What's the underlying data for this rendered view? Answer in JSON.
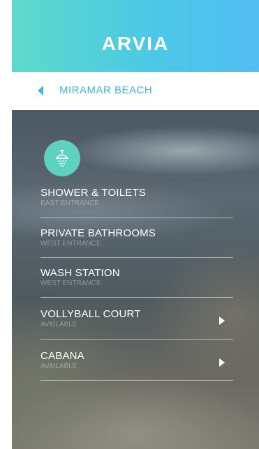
{
  "header": {
    "title": "ARVIA"
  },
  "nav": {
    "title": "MIRAMAR BEACH",
    "back_icon": "back-arrow-icon"
  },
  "category": {
    "icon": "shower-icon",
    "color": "#5ed1bf"
  },
  "facilities": [
    {
      "name": "SHOWER & TOILETS",
      "sub": "EAST ENTRANCE",
      "has_chevron": false
    },
    {
      "name": "PRIVATE BATHROOMS",
      "sub": "WEST ENTRANCE",
      "has_chevron": false
    },
    {
      "name": "WASH STATION",
      "sub": "WEST ENTRANCE",
      "has_chevron": false
    },
    {
      "name": "VOLLYBALL COURT",
      "sub": "AVAILABLE",
      "has_chevron": true
    },
    {
      "name": "CABANA",
      "sub": "AVAILABLE",
      "has_chevron": true
    }
  ],
  "colors": {
    "accent": "#3fb6e3",
    "teal": "#5ed9c8"
  }
}
